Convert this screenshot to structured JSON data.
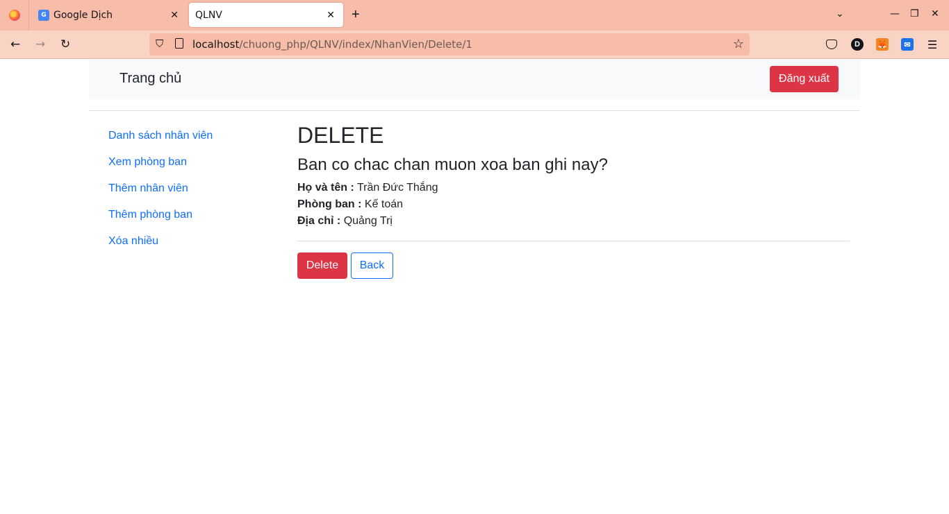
{
  "browser": {
    "tabs": [
      {
        "title": "Google Dịch",
        "icon": "google-translate-icon"
      },
      {
        "title": "QLNV",
        "active": true
      }
    ],
    "url_host": "localhost",
    "url_path": "/chuong_php/QLNV/index/NhanVien/Delete/1",
    "extension_d_label": "D"
  },
  "navbar": {
    "brand": "Trang chủ",
    "logout_label": "Đăng xuất"
  },
  "sidebar": {
    "items": [
      {
        "label": "Danh sách nhân viên"
      },
      {
        "label": "Xem phòng ban"
      },
      {
        "label": "Thêm nhân viên"
      },
      {
        "label": "Thêm phòng ban"
      },
      {
        "label": "Xóa nhiều"
      }
    ]
  },
  "main": {
    "heading": "DELETE",
    "confirm": "Ban co chac chan muon xoa ban ghi nay?",
    "fields": [
      {
        "label": "Họ và tên :",
        "value": "Trần Đức Thắng"
      },
      {
        "label": "Phòng ban :",
        "value": "Kế toán"
      },
      {
        "label": "Địa chỉ :",
        "value": "Quảng Trị"
      }
    ],
    "delete_label": "Delete",
    "back_label": "Back"
  },
  "colors": {
    "danger": "#dc3545",
    "primary": "#0d6efd",
    "chrome": "#f7bda8"
  }
}
